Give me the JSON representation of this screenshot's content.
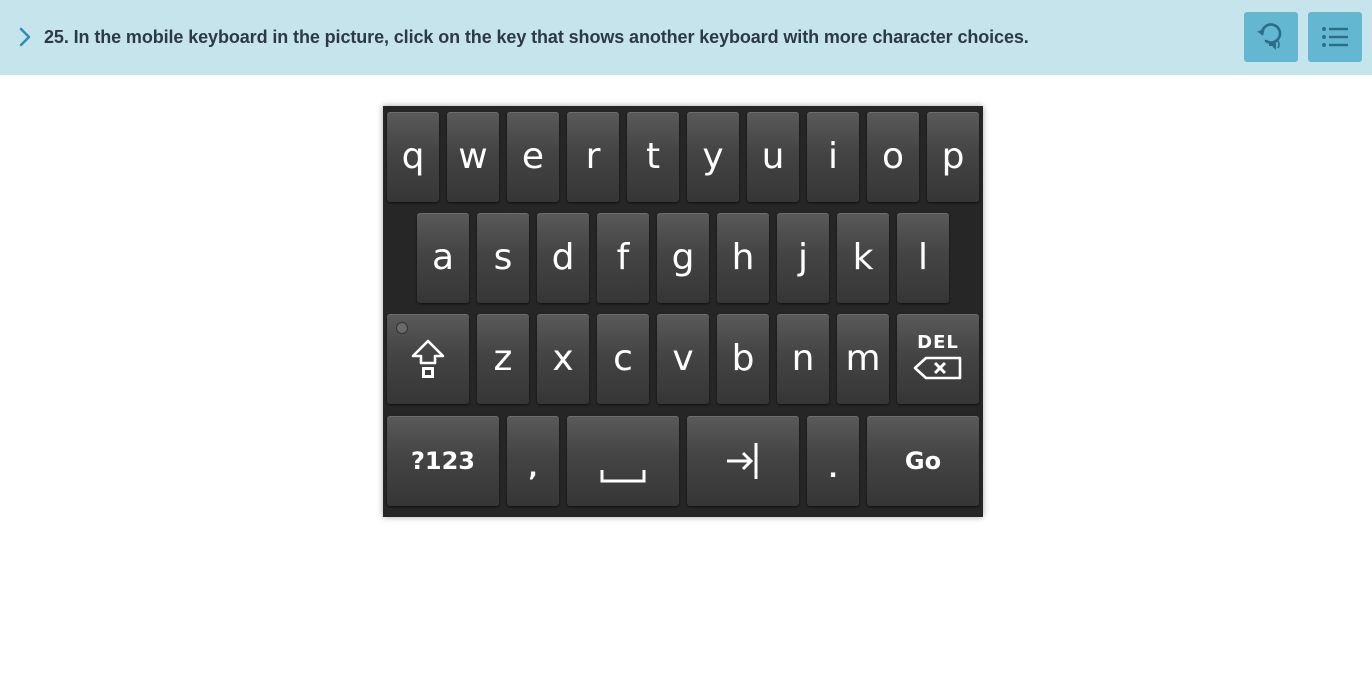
{
  "question": {
    "text": "25. In the mobile keyboard in the picture, click on the key that shows another keyboard with more character choices."
  },
  "header_buttons": {
    "replay_icon": "replay-audio-icon",
    "menu_icon": "list-menu-icon"
  },
  "colors": {
    "header_bg": "#c6e4ec",
    "button_bg": "#64b7d0",
    "chevron": "#2a8fb8",
    "keyboard_bg": "#262626",
    "key": "#444444"
  },
  "keyboard": {
    "row1": [
      "q",
      "w",
      "e",
      "r",
      "t",
      "y",
      "u",
      "i",
      "o",
      "p"
    ],
    "row2": [
      "a",
      "s",
      "d",
      "f",
      "g",
      "h",
      "j",
      "k",
      "l"
    ],
    "row3": [
      "z",
      "x",
      "c",
      "v",
      "b",
      "n",
      "m"
    ],
    "shift_icon": "shift-arrow-icon",
    "del_label": "DEL",
    "del_icon": "backspace-icon",
    "symbols_label": "?123",
    "comma_label": ",",
    "space_icon": "space-bar-icon",
    "tab_icon": "tab-arrow-icon",
    "period_label": ".",
    "go_label": "Go"
  }
}
